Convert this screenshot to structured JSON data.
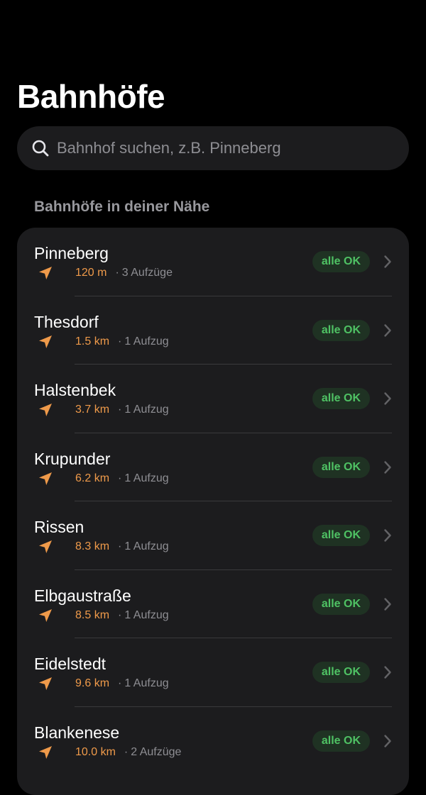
{
  "header": {
    "title": "Bahnhöfe"
  },
  "search": {
    "placeholder": "Bahnhof suchen, z.B. Pinneberg",
    "icon": "search-icon"
  },
  "nearby": {
    "section_title": "Bahnhöfe in deiner Nähe",
    "separator": "·",
    "icons": {
      "location": "location-arrow-icon",
      "disclosure": "chevron-right-icon"
    },
    "colors": {
      "distance": "#ef9a4a",
      "status_text": "#4fc264",
      "status_background": "#1f3223",
      "card_background": "#1c1c1e"
    },
    "stations": [
      {
        "name": "Pinneberg",
        "distance": "120 m",
        "elevators": "3 Aufzüge",
        "status": "alle OK"
      },
      {
        "name": "Thesdorf",
        "distance": "1.5 km",
        "elevators": "1 Aufzug",
        "status": "alle OK"
      },
      {
        "name": "Halstenbek",
        "distance": "3.7 km",
        "elevators": "1 Aufzug",
        "status": "alle OK"
      },
      {
        "name": "Krupunder",
        "distance": "6.2 km",
        "elevators": "1 Aufzug",
        "status": "alle OK"
      },
      {
        "name": "Rissen",
        "distance": "8.3 km",
        "elevators": "1 Aufzug",
        "status": "alle OK"
      },
      {
        "name": "Elbgaustraße",
        "distance": "8.5 km",
        "elevators": "1 Aufzug",
        "status": "alle OK"
      },
      {
        "name": "Eidelstedt",
        "distance": "9.6 km",
        "elevators": "1 Aufzug",
        "status": "alle OK"
      },
      {
        "name": "Blankenese",
        "distance": "10.0 km",
        "elevators": "2 Aufzüge",
        "status": "alle OK"
      }
    ]
  }
}
